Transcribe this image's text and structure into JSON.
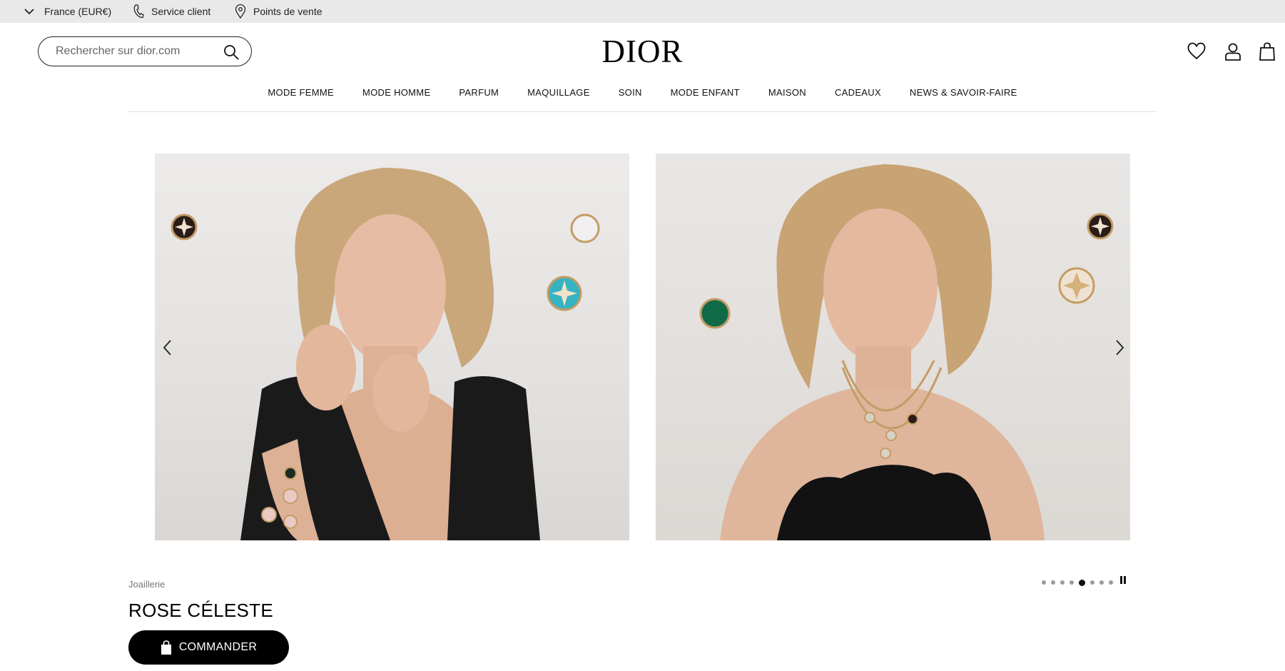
{
  "topbar": {
    "country": "France (EUR€)",
    "service": "Service client",
    "stores": "Points de vente"
  },
  "search": {
    "placeholder": "Rechercher sur dior.com"
  },
  "logo": "DIOR",
  "nav": [
    "MODE FEMME",
    "MODE HOMME",
    "PARFUM",
    "MAQUILLAGE",
    "SOIN",
    "MODE ENFANT",
    "MAISON",
    "CADEAUX",
    "NEWS & SAVOIR-FAIRE"
  ],
  "product": {
    "category": "Joaillerie",
    "title": "ROSE CÉLESTE",
    "cta": "COMMANDER"
  },
  "carousel": {
    "slide_count": 8,
    "active_index": 4
  },
  "icons": {
    "topbar": [
      "chevron-down-icon",
      "phone-icon",
      "location-pin-icon"
    ],
    "header": [
      "search-icon",
      "heart-icon",
      "user-icon",
      "shopping-bag-icon"
    ],
    "carousel": [
      "chevron-left-icon",
      "chevron-right-icon",
      "pause-icon"
    ]
  },
  "colors": {
    "topbar_bg": "#e9e9e9",
    "cta_bg": "#000000",
    "text": "#111111"
  }
}
